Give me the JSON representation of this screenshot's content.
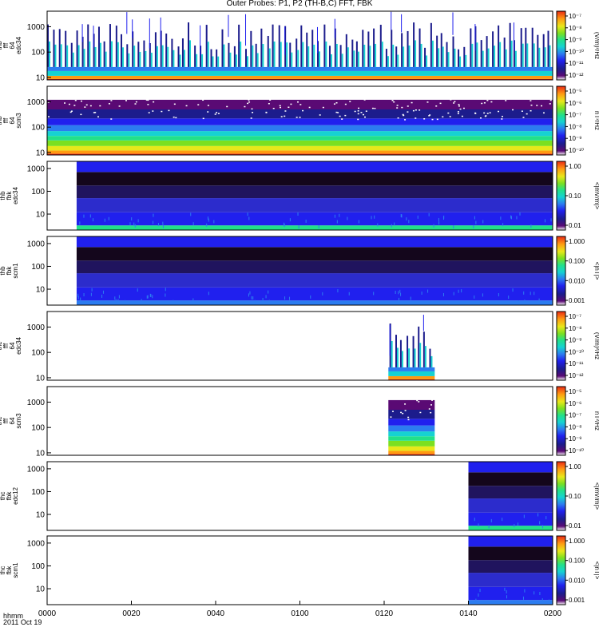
{
  "title": "Outer Probes: P1, P2 (TH-B,C) FFT, FBK",
  "x_axis": {
    "label_line1": "hhmm",
    "label_line2": "2011 Oct 19",
    "ticks": [
      "0000",
      "0020",
      "0040",
      "0100",
      "0120",
      "0140",
      "0200"
    ]
  },
  "colors": {
    "colormap": [
      "#ffffff",
      "#5a0a74",
      "#1c1c8c",
      "#2020ee",
      "#2c7cf0",
      "#16d2d2",
      "#22e08a",
      "#7ce020",
      "#e8e81a",
      "#ff9a12",
      "#ea2a14"
    ],
    "background": "#ffffff",
    "frame": "#000000"
  },
  "chart_data": [
    {
      "type": "heatmap",
      "ylabel": [
        "thb",
        "fff",
        "64",
        "edc34"
      ],
      "yticks": [
        "10",
        "100",
        "1000"
      ],
      "yscale": "log",
      "ylim": [
        8,
        4096
      ],
      "colorbar": {
        "label": "(V/m)²/Hz",
        "ticks": [
          "10⁻⁷",
          "10⁻⁸",
          "10⁻⁹",
          "10⁻¹⁰",
          "10⁻¹¹",
          "10⁻¹²"
        ],
        "scale": "log"
      },
      "x_coverage_min": [
        0,
        120
      ],
      "pattern": "bursts"
    },
    {
      "type": "heatmap",
      "ylabel": [
        "thb",
        "fff",
        "64",
        "scm3"
      ],
      "yticks": [
        "10",
        "100",
        "1000"
      ],
      "yscale": "log",
      "ylim": [
        8,
        4096
      ],
      "colorbar": {
        "label": "nT²/Hz",
        "ticks": [
          "10⁻⁵",
          "10⁻⁶",
          "10⁻⁷",
          "10⁻⁸",
          "10⁻⁹",
          "10⁻¹⁰"
        ],
        "scale": "log"
      },
      "x_coverage_min": [
        0,
        120
      ],
      "pattern": "scm"
    },
    {
      "type": "heatmap",
      "ylabel": [
        "thb",
        "fbk",
        "edc34"
      ],
      "yticks": [
        "10",
        "100",
        "1000"
      ],
      "yscale": "log",
      "ylim": [
        2,
        2048
      ],
      "colorbar": {
        "label": "<|mV/m|>",
        "ticks": [
          "1.00",
          "0.10",
          "0.01"
        ],
        "scale": "log"
      },
      "x_coverage_min": [
        7,
        120
      ],
      "pattern": "fbk-e"
    },
    {
      "type": "heatmap",
      "ylabel": [
        "thb",
        "fbk",
        "scm1"
      ],
      "yticks": [
        "10",
        "100",
        "1000"
      ],
      "yscale": "log",
      "ylim": [
        2,
        2048
      ],
      "colorbar": {
        "label": "<|nT|>",
        "ticks": [
          "1.000",
          "0.100",
          "0.010",
          "0.001"
        ],
        "scale": "log"
      },
      "x_coverage_min": [
        7,
        120
      ],
      "pattern": "fbk-b"
    },
    {
      "type": "heatmap",
      "ylabel": [
        "thc",
        "fff",
        "64",
        "edc34"
      ],
      "yticks": [
        "10",
        "100",
        "1000"
      ],
      "yscale": "log",
      "ylim": [
        8,
        4096
      ],
      "colorbar": {
        "label": "(V/m)²/Hz",
        "ticks": [
          "10⁻⁷",
          "10⁻⁸",
          "10⁻⁹",
          "10⁻¹⁰",
          "10⁻¹¹",
          "10⁻¹²"
        ],
        "scale": "log"
      },
      "x_coverage_min": [
        81,
        92
      ],
      "pattern": "bursts"
    },
    {
      "type": "heatmap",
      "ylabel": [
        "thc",
        "fff",
        "64",
        "scm3"
      ],
      "yticks": [
        "10",
        "100",
        "1000"
      ],
      "yscale": "log",
      "ylim": [
        8,
        4096
      ],
      "colorbar": {
        "label": "nT²/Hz",
        "ticks": [
          "10⁻⁵",
          "10⁻⁶",
          "10⁻⁷",
          "10⁻⁸",
          "10⁻⁹",
          "10⁻¹⁰"
        ],
        "scale": "log"
      },
      "x_coverage_min": [
        81,
        92
      ],
      "pattern": "scm"
    },
    {
      "type": "heatmap",
      "ylabel": [
        "thc",
        "fbk",
        "edc12"
      ],
      "yticks": [
        "10",
        "100",
        "1000"
      ],
      "yscale": "log",
      "ylim": [
        2,
        2048
      ],
      "colorbar": {
        "label": "<|mV/m|>",
        "ticks": [
          "1.00",
          "0.10",
          "0.01"
        ],
        "scale": "log"
      },
      "x_coverage_min": [
        100,
        120
      ],
      "pattern": "fbk-e"
    },
    {
      "type": "heatmap",
      "ylabel": [
        "thc",
        "fbk",
        "scm1"
      ],
      "yticks": [
        "10",
        "100",
        "1000"
      ],
      "yscale": "log",
      "ylim": [
        2,
        2048
      ],
      "colorbar": {
        "label": "<|nT|>",
        "ticks": [
          "1.000",
          "0.100",
          "0.010",
          "0.001"
        ],
        "scale": "log"
      },
      "x_coverage_min": [
        100,
        120
      ],
      "pattern": "fbk-b"
    }
  ]
}
